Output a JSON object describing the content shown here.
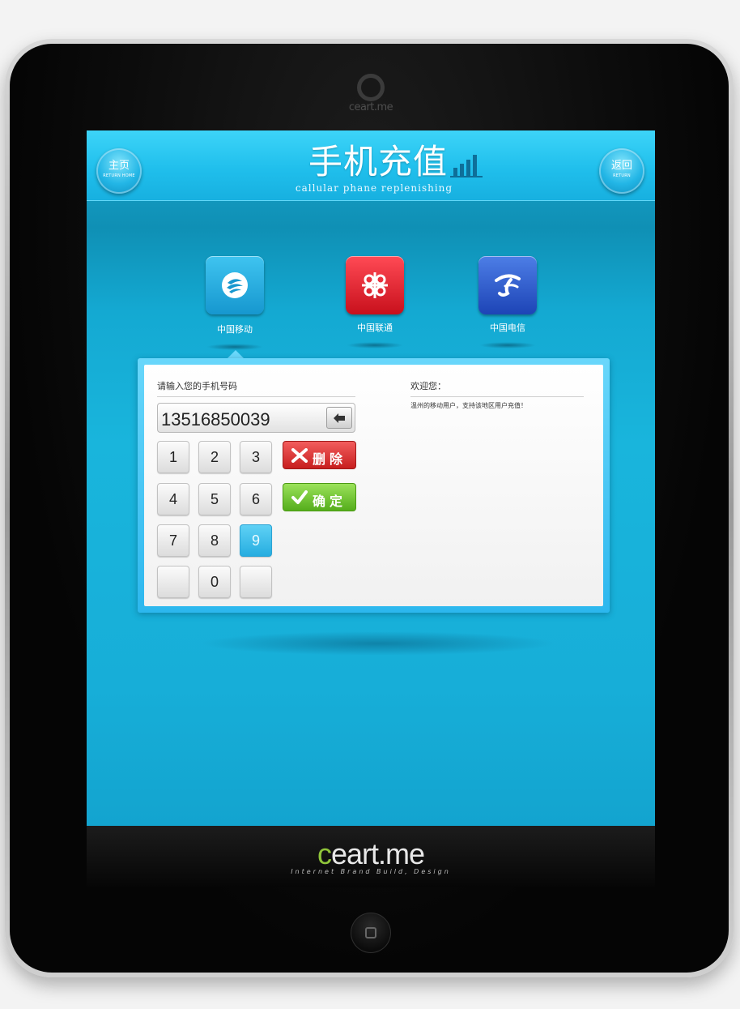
{
  "device": {
    "camera_brand": "ceart.me",
    "footer_logo_mark": "c",
    "footer_logo_text": "eart.me",
    "footer_tagline": "Internet Brand Build, Design"
  },
  "header": {
    "home_label": "主页",
    "home_sublabel": "RETURN HOME",
    "back_label": "返回",
    "back_sublabel": "RETURN",
    "title": "手机充值",
    "subtitle": "callular phane replenishing"
  },
  "carriers": [
    {
      "name": "中国移动",
      "icon": "china-mobile-logo",
      "color": "#1697cf",
      "selected": true
    },
    {
      "name": "中国联通",
      "icon": "china-unicom-knot-logo",
      "color": "#c8101c",
      "selected": false
    },
    {
      "name": "中国电信",
      "icon": "china-telecom-logo",
      "color": "#1d44b6",
      "selected": false
    }
  ],
  "form": {
    "prompt": "请输入您的手机号码",
    "phone_value": "13516850039",
    "keys": [
      "1",
      "2",
      "3",
      "4",
      "5",
      "6",
      "7",
      "8",
      "9",
      "0"
    ],
    "active_key": "9",
    "delete_label": "删除",
    "confirm_label": "确定"
  },
  "welcome": {
    "title": "欢迎您：",
    "message": "温州的移动用户，支持该地区用户充值！"
  },
  "colors": {
    "accent": "#19b5dc",
    "delete": "#c71e1e",
    "confirm": "#54ad1b"
  }
}
